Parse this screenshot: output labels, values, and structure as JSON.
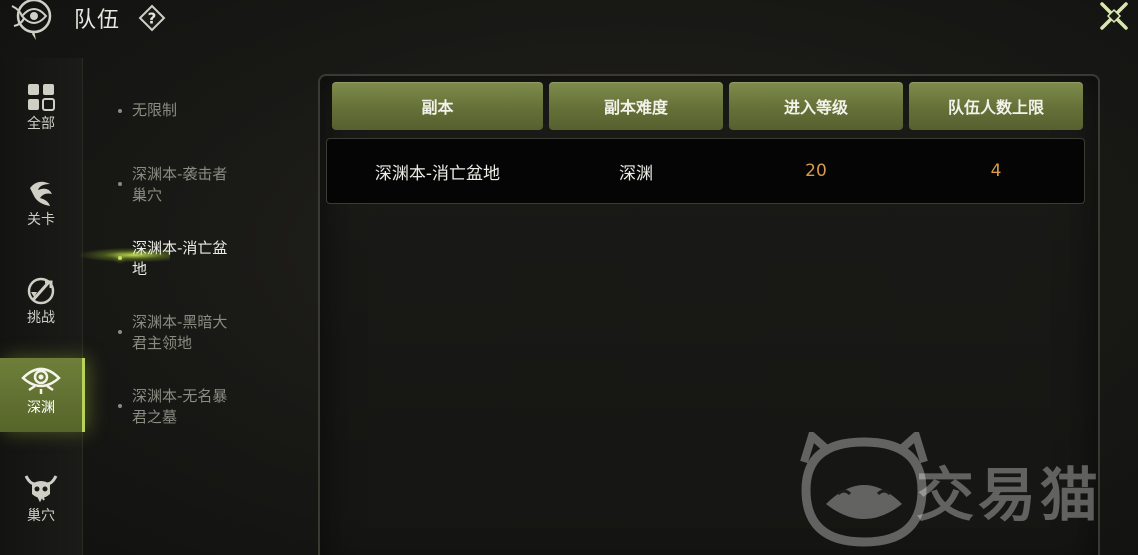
{
  "header": {
    "title": "队伍",
    "help_glyph": "?"
  },
  "categories": [
    {
      "label": "全部",
      "icon": "grid-icon",
      "active": false
    },
    {
      "label": "关卡",
      "icon": "swirl-icon",
      "active": false
    },
    {
      "label": "挑战",
      "icon": "sword-icon",
      "active": false
    },
    {
      "label": "深渊",
      "icon": "eye-icon",
      "active": true
    },
    {
      "label": "巢穴",
      "icon": "skull-icon",
      "active": false
    }
  ],
  "dungeons": [
    {
      "line1": "无限制",
      "line2": "",
      "active": false
    },
    {
      "line1": "深渊本-袭击者",
      "line2": "巢穴",
      "active": false
    },
    {
      "line1": "深渊本-消亡盆",
      "line2": "地",
      "active": true
    },
    {
      "line1": "深渊本-黑暗大",
      "line2": "君主领地",
      "active": false
    },
    {
      "line1": "深渊本-无名暴",
      "line2": "君之墓",
      "active": false
    }
  ],
  "table": {
    "headers": [
      "副本",
      "副本难度",
      "进入等级",
      "队伍人数上限"
    ],
    "rows": [
      {
        "dungeon": "深渊本-消亡盆地",
        "difficulty": "深渊",
        "level": "20",
        "max_players": "4"
      }
    ]
  },
  "watermark": {
    "text": "交易猫"
  },
  "colors": {
    "accent": "#b9d25a",
    "header_green": "#6b773c",
    "level_orange": "#d89a4c"
  }
}
